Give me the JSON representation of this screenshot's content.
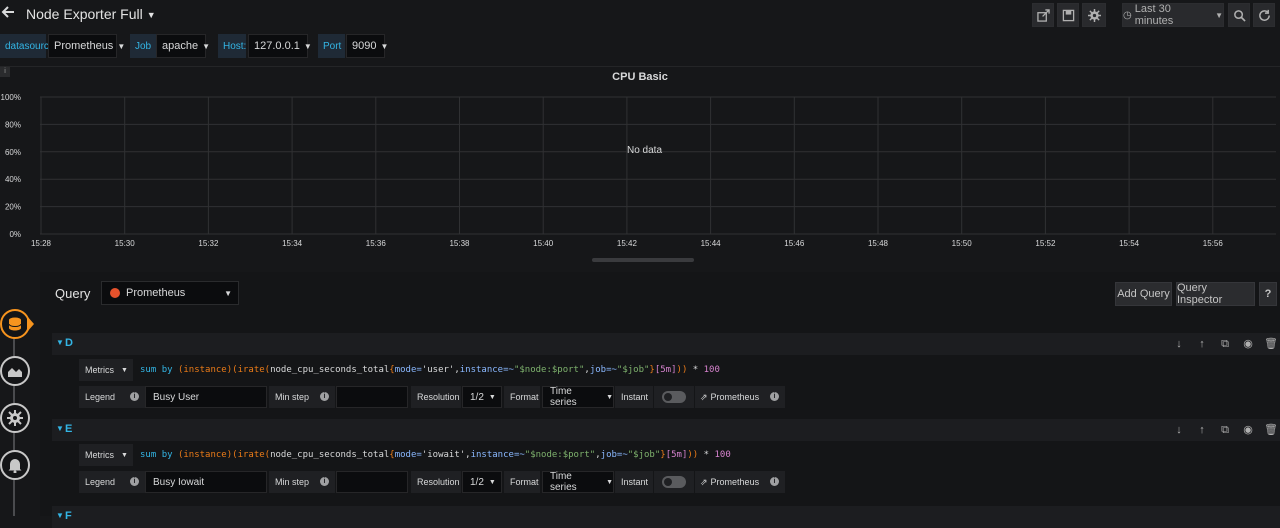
{
  "header": {
    "title": "Node Exporter Full",
    "time_range": "Last 30 minutes"
  },
  "variables": [
    {
      "label": "datasource",
      "value": "Prometheus"
    },
    {
      "label": "Job",
      "value": "apache"
    },
    {
      "label": "Host:",
      "value": "127.0.0.1"
    },
    {
      "label": "Port",
      "value": "9090"
    }
  ],
  "panel": {
    "title": "CPU Basic",
    "message": "No data",
    "corner_label": "i"
  },
  "chart_data": {
    "type": "line",
    "title": "CPU Basic",
    "y_ticks": [
      "100%",
      "80%",
      "60%",
      "40%",
      "20%",
      "0%"
    ],
    "x_ticks": [
      "15:28",
      "15:30",
      "15:32",
      "15:34",
      "15:36",
      "15:38",
      "15:40",
      "15:42",
      "15:44",
      "15:46",
      "15:48",
      "15:50",
      "15:52",
      "15:54",
      "15:56"
    ],
    "ylim": [
      0,
      100
    ],
    "series": [],
    "grid": true,
    "colors": {
      "grid": "#303133",
      "text": "#d8d9da"
    }
  },
  "editor": {
    "query_label": "Query",
    "datasource": "Prometheus",
    "add_query": "Add Query",
    "query_inspector": "Query Inspector",
    "help": "?",
    "queries": [
      {
        "id": "D",
        "metrics_label": "Metrics",
        "expr_parts": [
          {
            "t": "sum ",
            "c": "c-kw"
          },
          {
            "t": "by ",
            "c": "c-kw"
          },
          {
            "t": "(instance)",
            "c": "c-brk"
          },
          {
            "t": "(",
            "c": "c-brk"
          },
          {
            "t": "irate",
            "c": "c-fn"
          },
          {
            "t": "(",
            "c": "c-brk"
          },
          {
            "t": "node_cpu_seconds_total",
            "c": ""
          },
          {
            "t": "{",
            "c": "c-brk"
          },
          {
            "t": "mode=",
            "c": "c-lbl"
          },
          {
            "t": "'user'",
            "c": ""
          },
          {
            "t": ",",
            "c": ""
          },
          {
            "t": "instance=~",
            "c": "c-lbl"
          },
          {
            "t": "\"$node:$port\"",
            "c": "c-str"
          },
          {
            "t": ",",
            "c": ""
          },
          {
            "t": "job=~",
            "c": "c-lbl"
          },
          {
            "t": "\"$job\"",
            "c": "c-str"
          },
          {
            "t": "}",
            "c": "c-brk"
          },
          {
            "t": "[5m]",
            "c": "c-num"
          },
          {
            "t": "))",
            "c": "c-brk"
          },
          {
            "t": " * ",
            "c": ""
          },
          {
            "t": "100",
            "c": "c-num"
          }
        ],
        "legend_label": "Legend",
        "legend_value": "Busy User",
        "min_step_label": "Min step",
        "resolution_label": "Resolution",
        "resolution_value": "1/2",
        "format_label": "Format",
        "format_value": "Time series",
        "instant_label": "Instant",
        "prom_link": "Prometheus"
      },
      {
        "id": "E",
        "metrics_label": "Metrics",
        "expr_parts": [
          {
            "t": "sum ",
            "c": "c-kw"
          },
          {
            "t": "by ",
            "c": "c-kw"
          },
          {
            "t": "(instance)",
            "c": "c-brk"
          },
          {
            "t": "(",
            "c": "c-brk"
          },
          {
            "t": "irate",
            "c": "c-fn"
          },
          {
            "t": "(",
            "c": "c-brk"
          },
          {
            "t": "node_cpu_seconds_total",
            "c": ""
          },
          {
            "t": "{",
            "c": "c-brk"
          },
          {
            "t": "mode=",
            "c": "c-lbl"
          },
          {
            "t": "'iowait'",
            "c": ""
          },
          {
            "t": ",",
            "c": ""
          },
          {
            "t": "instance=~",
            "c": "c-lbl"
          },
          {
            "t": "\"$node:$port\"",
            "c": "c-str"
          },
          {
            "t": ",",
            "c": ""
          },
          {
            "t": "job=~",
            "c": "c-lbl"
          },
          {
            "t": "\"$job\"",
            "c": "c-str"
          },
          {
            "t": "}",
            "c": "c-brk"
          },
          {
            "t": "[5m]",
            "c": "c-num"
          },
          {
            "t": "))",
            "c": "c-brk"
          },
          {
            "t": " * ",
            "c": ""
          },
          {
            "t": "100",
            "c": "c-num"
          }
        ],
        "legend_label": "Legend",
        "legend_value": "Busy Iowait",
        "min_step_label": "Min step",
        "resolution_label": "Resolution",
        "resolution_value": "1/2",
        "format_label": "Format",
        "format_value": "Time series",
        "instant_label": "Instant",
        "prom_link": "Prometheus"
      },
      {
        "id": "F"
      }
    ]
  }
}
